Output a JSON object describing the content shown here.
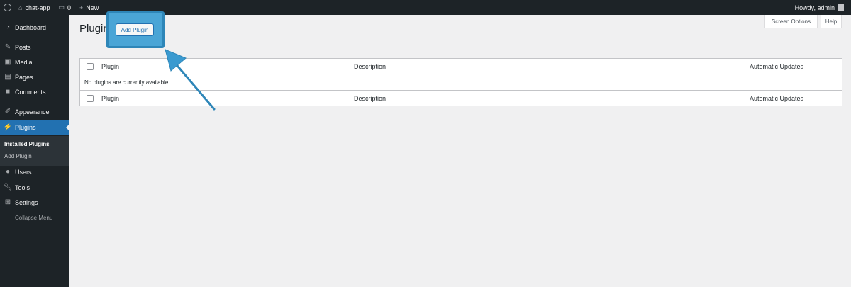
{
  "adminbar": {
    "site_name": "chat-app",
    "comments_count": "0",
    "new_label": "New",
    "howdy": "Howdy, admin"
  },
  "sidebar": {
    "items": [
      {
        "label": "Dashboard",
        "icon": "dashboard-icon"
      },
      {
        "label": "Posts",
        "icon": "pin-icon"
      },
      {
        "label": "Media",
        "icon": "media-icon"
      },
      {
        "label": "Pages",
        "icon": "pages-icon"
      },
      {
        "label": "Comments",
        "icon": "comments-icon"
      },
      {
        "label": "Appearance",
        "icon": "brush-icon"
      },
      {
        "label": "Plugins",
        "icon": "plugin-icon"
      },
      {
        "label": "Users",
        "icon": "users-icon"
      },
      {
        "label": "Tools",
        "icon": "wrench-icon"
      },
      {
        "label": "Settings",
        "icon": "settings-icon"
      }
    ],
    "submenu": [
      "Installed Plugins",
      "Add Plugin"
    ],
    "collapse": "Collapse Menu"
  },
  "header": {
    "title": "Plugins",
    "add_plugin": "Add Plugin",
    "screen_options": "Screen Options",
    "help": "Help"
  },
  "table": {
    "columns": [
      "Plugin",
      "Description",
      "Automatic Updates"
    ],
    "empty_message": "No plugins are currently available."
  },
  "colors": {
    "accent": "#2271b1",
    "sidebar_bg": "#1d2327",
    "highlight": "#4aa5d6"
  }
}
